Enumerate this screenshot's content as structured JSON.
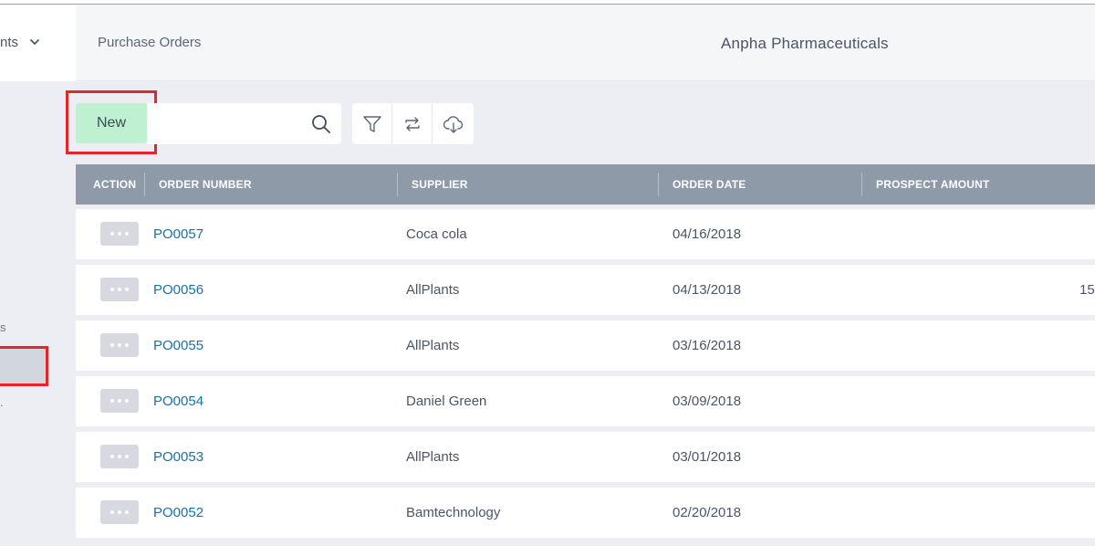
{
  "sidebar": {
    "app_label": "nts",
    "item_a": "s",
    "item_b": "."
  },
  "header": {
    "breadcrumb": "Purchase Orders",
    "company": "Anpha Pharmaceuticals"
  },
  "toolbar": {
    "new_label": "New",
    "search_value": "",
    "search_placeholder": ""
  },
  "table": {
    "columns": [
      "ACTION",
      "ORDER NUMBER",
      "SUPPLIER",
      "ORDER DATE",
      "PROSPECT AMOUNT"
    ],
    "rows": [
      {
        "order": "PO0057",
        "supplier": "Coca cola",
        "date": "04/16/2018",
        "amount": ""
      },
      {
        "order": "PO0056",
        "supplier": "AllPlants",
        "date": "04/13/2018",
        "amount": "15"
      },
      {
        "order": "PO0055",
        "supplier": "AllPlants",
        "date": "03/16/2018",
        "amount": ""
      },
      {
        "order": "PO0054",
        "supplier": "Daniel Green",
        "date": "03/09/2018",
        "amount": ""
      },
      {
        "order": "PO0053",
        "supplier": "AllPlants",
        "date": "03/01/2018",
        "amount": ""
      },
      {
        "order": "PO0052",
        "supplier": "Bamtechnology",
        "date": "02/20/2018",
        "amount": ""
      }
    ]
  },
  "colors": {
    "new_button": "#bff0cf",
    "highlight": "#e3262b",
    "table_header": "#8e9aa7",
    "link": "#1c6fa0"
  }
}
